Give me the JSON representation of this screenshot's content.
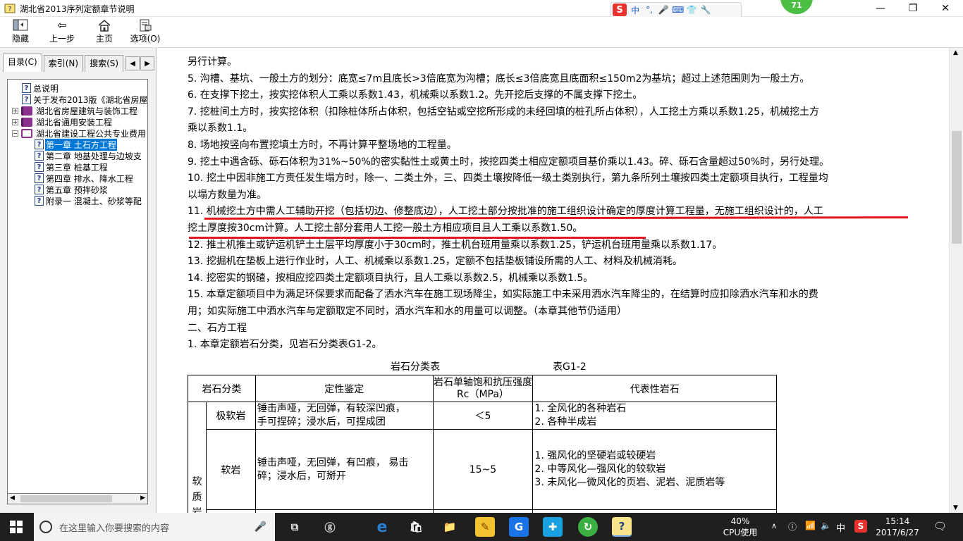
{
  "window": {
    "title": "湖北省2013序列定额章节说明",
    "minimize": "—",
    "maximize": "❐",
    "close": "✕"
  },
  "ime": {
    "logo": "S",
    "mode": "中",
    "punct": "°,",
    "mic": "🎤",
    "kbd": "⌨",
    "skin": "👕",
    "tools": "🔧"
  },
  "badge": "71",
  "toolbar": {
    "hide": "隐藏",
    "back": "上一步",
    "home": "主页",
    "options": "选项(O)"
  },
  "left": {
    "tabs": [
      "目录(C)",
      "索引(N)",
      "搜索(S)"
    ],
    "tree": [
      {
        "label": "总说明",
        "icon": "help"
      },
      {
        "label": "关于发布2013版《湖北省房屋",
        "icon": "help"
      },
      {
        "label": "湖北省房屋建筑与装饰工程",
        "icon": "book",
        "expander": "+"
      },
      {
        "label": "湖北省通用安装工程",
        "icon": "book",
        "expander": "+"
      },
      {
        "label": "湖北省建设工程公共专业费用",
        "icon": "book-open",
        "expander": "−"
      },
      {
        "label": "第一章 土石方工程",
        "icon": "help",
        "selected": true
      },
      {
        "label": "第二章 地基处理与边坡支",
        "icon": "help"
      },
      {
        "label": "第三章 桩基工程",
        "icon": "help"
      },
      {
        "label": "第四章 排水、降水工程",
        "icon": "help"
      },
      {
        "label": "第五章 预拌砂浆",
        "icon": "help"
      },
      {
        "label": "附录一 混凝土、砂浆等配",
        "icon": "help"
      }
    ]
  },
  "content": {
    "lines": [
      "另行计算。",
      "5. 沟槽、基坑、一般土方的划分：底宽≤7m且底长>3倍底宽为沟槽；底长≤3倍底宽且底面积≤150m2为基坑；超过上述范围则为一般土方。",
      "6. 在支撑下挖土，按实挖体积人工乘以系数1.43，机械乘以系数1.2。先开挖后支撑的不属支撑下挖土。",
      "7. 挖桩间土方时，按实挖体积（扣除桩体所占体积，包括空钻或空挖所形成的未经回填的桩孔所占体积），人工挖土方乘以系数1.25，机械挖土方",
      "乘以系数1.1。",
      "8. 场地按竖向布置挖填土方时，不再计算平整场地的工程量。",
      "9. 挖土中遇含砾、砾石体积为31%~50%的密实黏性土或黄土时，按挖四类土相应定额项目基价乘以1.43。碎、砾石含量超过50%时，另行处理。",
      "10. 挖土中因非施工方责任发生塌方时，除一、二类土外，三、四类土壤按降低一级土类别执行，第九条所列土壤按四类土定额项目执行，工程量均",
      "以塌方数量为准。",
      "11. 机械挖土方中需人工辅助开挖（包括切边、修整底边），人工挖土部分按批准的施工组织设计确定的厚度计算工程量，无施工组织设计的，人工",
      "挖土厚度按30cm计算。人工挖土部分套用人工挖一般土方相应项目且人工乘以系数1.50。",
      "12. 推土机推土或铲运机铲土土层平均厚度小于30cm时，推土机台班用量乘以系数1.25，铲运机台班用量乘以系数1.17。",
      "13. 挖掘机在垫板上进行作业时，人工、机械乘以系数1.25，定额不包括垫板铺设所需的人工、材料及机械消耗。",
      "14. 挖密实的钢碴，按相应挖四类土定额项目执行，且人工乘以系数2.5，机械乘以系数1.5。",
      "15. 本章定额项目中为满足环保要求而配备了洒水汽车在施工现场降尘，如实际施工中未采用洒水汽车降尘的，在结算时应扣除洒水汽车和水的费",
      "用；如实际施工中洒水汽车与定额取定不同时，洒水汽车和水的用量可以调整。（本章其他节仍适用）",
      "二、石方工程",
      "1. 本章定额岩石分类，见岩石分类表G1-2。"
    ],
    "table_caption": "岩石分类表",
    "table_id": "表G1-2",
    "table": {
      "headers": [
        "岩石分类",
        "定性鉴定",
        "岩石单轴饱和抗压强度Rc（MPa）",
        "代表性岩石"
      ],
      "group": "软质岩",
      "rows": [
        {
          "name": "极软岩",
          "qual": [
            "锤击声哑，无回弹，有较深凹痕，",
            "手可捏碎；浸水后，可捏成团"
          ],
          "rc": "＜5",
          "rep": [
            "1. 全风化的各种岩石",
            "2. 各种半成岩"
          ]
        },
        {
          "name": "软岩",
          "qual": [
            "锤击声哑，无回弹，有凹痕， 易击",
            "碎；浸水后，可掰开"
          ],
          "rc": "15~5",
          "rep": [
            "1. 强风化的坚硬岩或较硬岩",
            "2. 中等风化—强风化的较软岩",
            "3. 未风化—微风化的页岩、泥岩、泥质岩等"
          ]
        }
      ]
    }
  },
  "taskbar": {
    "search_placeholder": "在这里输入你要搜索的内容",
    "cpu_percent": "40%",
    "cpu_label": "CPU使用",
    "ime": "中",
    "time": "15:14",
    "date": "2017/6/27"
  }
}
